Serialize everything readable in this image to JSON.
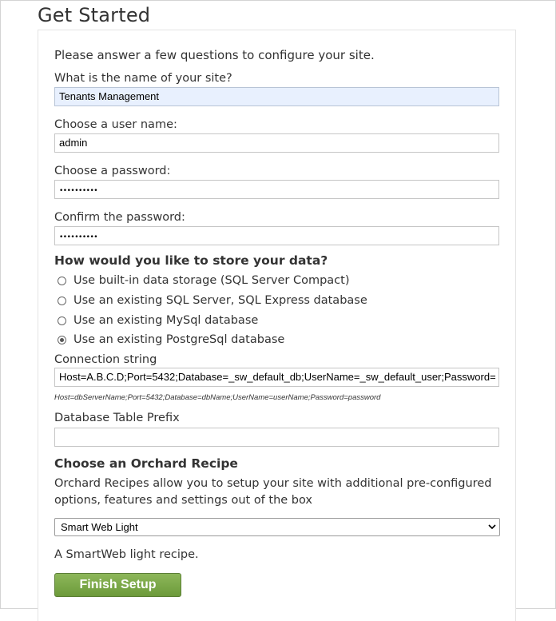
{
  "page": {
    "title": "Get Started"
  },
  "form": {
    "intro": "Please answer a few questions to configure your site.",
    "site_name": {
      "label": "What is the name of your site?",
      "value": "Tenants Management"
    },
    "user_name": {
      "label": "Choose a user name:",
      "value": "admin"
    },
    "password": {
      "label": "Choose a password:",
      "value": "••••••••••"
    },
    "confirm_password": {
      "label": "Confirm the password:",
      "value": "••••••••••"
    },
    "storage": {
      "heading": "How would you like to store your data?",
      "options": [
        {
          "label": "Use built-in data storage (SQL Server Compact)",
          "checked": false
        },
        {
          "label": "Use an existing SQL Server, SQL Express database",
          "checked": false
        },
        {
          "label": "Use an existing MySql database",
          "checked": false
        },
        {
          "label": "Use an existing PostgreSql database",
          "checked": true
        }
      ],
      "connection_string": {
        "label": "Connection string",
        "value": "Host=A.B.C.D;Port=5432;Database=_sw_default_db;UserName=_sw_default_user;Password=",
        "hint": "Host=dbServerName;Port=5432;Database=dbName;UserName=userName;Password=password"
      },
      "table_prefix": {
        "label": "Database Table Prefix",
        "value": ""
      }
    },
    "recipe": {
      "heading": "Choose an Orchard Recipe",
      "description": "Orchard Recipes allow you to setup your site with additional pre-configured options, features and settings out of the box",
      "selected": "Smart Web Light",
      "selected_description": "A SmartWeb light recipe."
    },
    "finish_label": "Finish Setup"
  },
  "icons": {
    "select": "chevron-down-icon"
  }
}
